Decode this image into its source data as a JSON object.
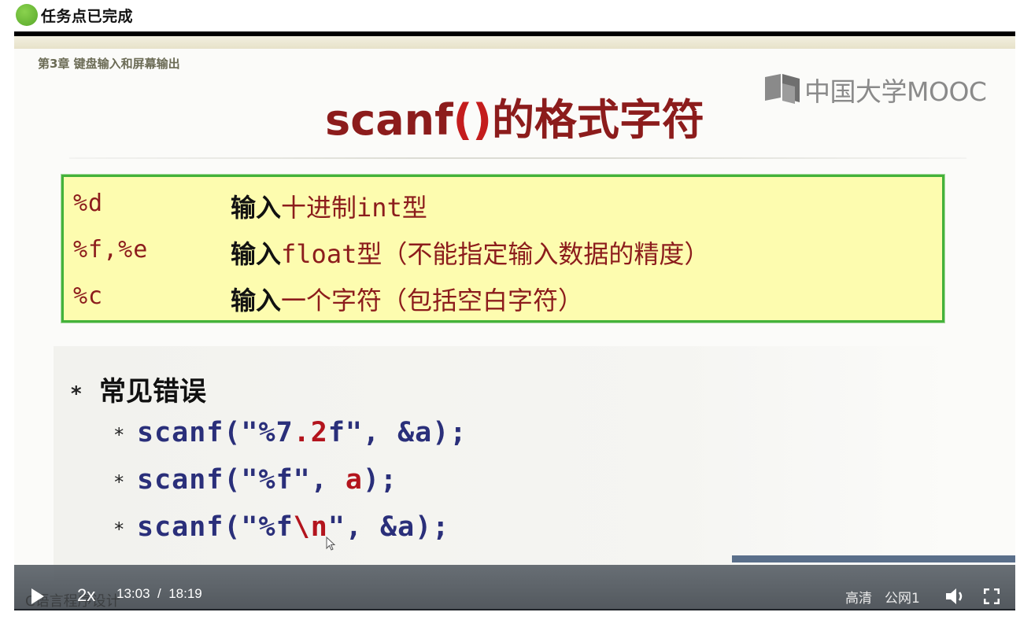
{
  "task_status": {
    "text": "任务点已完成"
  },
  "slide": {
    "chapter": "第3章 键盘输入和屏幕输出",
    "logo_text": "中国大学MOOC",
    "title": {
      "prefix": "scanf",
      "paren": "()",
      "suffix": "的格式字符"
    },
    "spec_rows": [
      {
        "code": "%d",
        "lead": "输入",
        "rest_a": "十进制",
        "mono": "int",
        "rest_b": "型"
      },
      {
        "code": "%f,%e",
        "lead": "输入",
        "rest_a": "",
        "mono": "float",
        "rest_b": "型（不能指定输入数据的精度）"
      },
      {
        "code": "%c",
        "lead": "输入",
        "rest_a": "一个字符（包括空白字符）",
        "mono": "",
        "rest_b": ""
      }
    ],
    "errors_heading": "常见错误",
    "bullet": "*",
    "error_lines": [
      {
        "a": "scanf(\"%7",
        "hl": ".2",
        "b": "f\", &a);"
      },
      {
        "a": "scanf(\"%f\", ",
        "hl": "a",
        "b": ");"
      },
      {
        "a": "scanf(\"%f",
        "hl": "\\n",
        "b": "\", &a);"
      }
    ]
  },
  "player": {
    "speed": "2x",
    "current_time": "13:03",
    "separator": "/",
    "duration": "18:19",
    "quality": "高清",
    "line": "公网1",
    "watermark": "C语言程序设计",
    "icons": [
      "play-icon",
      "volume-icon",
      "fullscreen-icon"
    ]
  },
  "colors": {
    "title_red": "#8c1c1c",
    "box_fill": "#fdfcaf",
    "box_border": "#44b23a",
    "code_blue": "#2a2f7a",
    "highlight_red": "#b3141d"
  }
}
